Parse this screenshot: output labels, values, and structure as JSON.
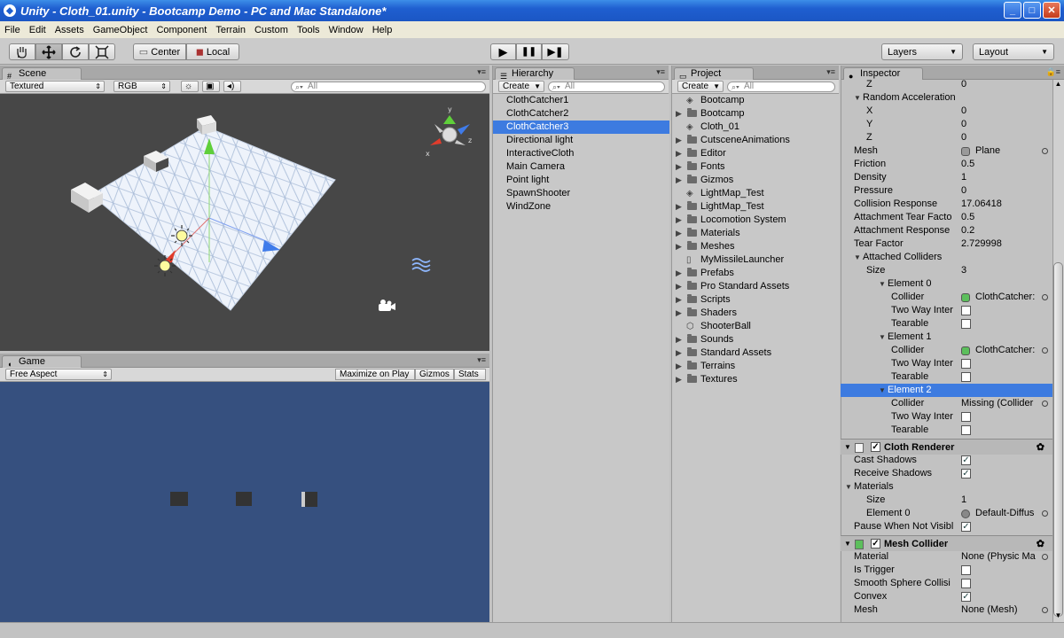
{
  "window": {
    "title": "Unity - Cloth_01.unity - Bootcamp Demo - PC and Mac Standalone*",
    "min": "_",
    "max": "□",
    "close": "✕"
  },
  "menu": [
    "File",
    "Edit",
    "Assets",
    "GameObject",
    "Component",
    "Terrain",
    "Custom",
    "Tools",
    "Window",
    "Help"
  ],
  "toolbar": {
    "tools": [
      "hand-icon",
      "move-icon",
      "rotate-icon",
      "scale-icon"
    ],
    "center_label": "Center",
    "local_label": "Local",
    "play_glyph": "▶",
    "pause_glyph": "❚❚",
    "step_glyph": "▶❚",
    "layers_label": "Layers",
    "layout_label": "Layout"
  },
  "scene": {
    "tab": "Scene",
    "render_mode": "Textured",
    "color_mode": "RGB",
    "search_placeholder": "All",
    "gizmo": {
      "x": "x",
      "y": "y",
      "z": "z"
    }
  },
  "game": {
    "tab": "Game",
    "aspect": "Free Aspect",
    "maximize": "Maximize on Play",
    "gizmos": "Gizmos",
    "stats": "Stats",
    "bg_color": "#36507f"
  },
  "hierarchy": {
    "tab": "Hierarchy",
    "create": "Create",
    "search_placeholder": "All",
    "items": [
      "ClothCatcher1",
      "ClothCatcher2",
      "ClothCatcher3",
      "Directional light",
      "InteractiveCloth",
      "Main Camera",
      "Point light",
      "SpawnShooter",
      "WindZone"
    ],
    "selected_index": 2
  },
  "project": {
    "tab": "Project",
    "create": "Create",
    "search_placeholder": "All",
    "items": [
      {
        "label": "Bootcamp",
        "icon": "unity-icon",
        "fold": false
      },
      {
        "label": "Bootcamp",
        "icon": "folder-icon",
        "fold": true
      },
      {
        "label": "Cloth_01",
        "icon": "unity-icon",
        "fold": false
      },
      {
        "label": "CutsceneAnimations",
        "icon": "folder-icon",
        "fold": true
      },
      {
        "label": "Editor",
        "icon": "folder-icon",
        "fold": true
      },
      {
        "label": "Fonts",
        "icon": "folder-icon",
        "fold": true
      },
      {
        "label": "Gizmos",
        "icon": "folder-icon",
        "fold": true
      },
      {
        "label": "LightMap_Test",
        "icon": "unity-icon",
        "fold": false
      },
      {
        "label": "LightMap_Test",
        "icon": "folder-icon",
        "fold": true
      },
      {
        "label": "Locomotion System",
        "icon": "folder-icon",
        "fold": true
      },
      {
        "label": "Materials",
        "icon": "folder-icon",
        "fold": true
      },
      {
        "label": "Meshes",
        "icon": "folder-icon",
        "fold": true
      },
      {
        "label": "MyMissileLauncher",
        "icon": "file-icon",
        "fold": false
      },
      {
        "label": "Prefabs",
        "icon": "folder-icon",
        "fold": true
      },
      {
        "label": "Pro Standard Assets",
        "icon": "folder-icon",
        "fold": true
      },
      {
        "label": "Scripts",
        "icon": "folder-icon",
        "fold": true
      },
      {
        "label": "Shaders",
        "icon": "folder-icon",
        "fold": true
      },
      {
        "label": "ShooterBall",
        "icon": "prefab-icon",
        "fold": false
      },
      {
        "label": "Sounds",
        "icon": "folder-icon",
        "fold": true
      },
      {
        "label": "Standard Assets",
        "icon": "folder-icon",
        "fold": true
      },
      {
        "label": "Terrains",
        "icon": "folder-icon",
        "fold": true
      },
      {
        "label": "Textures",
        "icon": "folder-icon",
        "fold": true
      }
    ]
  },
  "inspector": {
    "tab": "Inspector",
    "rows": [
      {
        "label": "Z",
        "indent": 2,
        "value": "0"
      },
      {
        "label": "Random Acceleration",
        "indent": 1,
        "fold": "open"
      },
      {
        "label": "X",
        "indent": 2,
        "value": "0"
      },
      {
        "label": "Y",
        "indent": 2,
        "value": "0"
      },
      {
        "label": "Z",
        "indent": 2,
        "value": "0"
      },
      {
        "label": "Mesh",
        "indent": 1,
        "value": "Plane",
        "object": true
      },
      {
        "label": "Friction",
        "indent": 1,
        "value": "0.5"
      },
      {
        "label": "Density",
        "indent": 1,
        "value": "1"
      },
      {
        "label": "Pressure",
        "indent": 1,
        "value": "0"
      },
      {
        "label": "Collision Response",
        "indent": 1,
        "value": "17.06418"
      },
      {
        "label": "Attachment Tear Facto",
        "indent": 1,
        "value": "0.5"
      },
      {
        "label": "Attachment Response",
        "indent": 1,
        "value": "0.2"
      },
      {
        "label": "Tear Factor",
        "indent": 1,
        "value": "2.729998"
      },
      {
        "label": "Attached Colliders",
        "indent": 1,
        "fold": "open"
      },
      {
        "label": "Size",
        "indent": 2,
        "value": "3"
      },
      {
        "label": "Element 0",
        "indent": 3,
        "fold": "open"
      },
      {
        "label": "Collider",
        "indent": 4,
        "value": "ClothCatcher:",
        "object": true,
        "goicon": true
      },
      {
        "label": "Two Way Inter",
        "indent": 4,
        "check": false
      },
      {
        "label": "Tearable",
        "indent": 4,
        "check": false
      },
      {
        "label": "Element 1",
        "indent": 3,
        "fold": "open"
      },
      {
        "label": "Collider",
        "indent": 4,
        "value": "ClothCatcher:",
        "object": true,
        "goicon": true
      },
      {
        "label": "Two Way Inter",
        "indent": 4,
        "check": false
      },
      {
        "label": "Tearable",
        "indent": 4,
        "check": false
      },
      {
        "label": "Element 2",
        "indent": 3,
        "fold": "open",
        "selected": true
      },
      {
        "label": "Collider",
        "indent": 4,
        "value": "Missing (Collider",
        "object": true
      },
      {
        "label": "Two Way Inter",
        "indent": 4,
        "check": false
      },
      {
        "label": "Tearable",
        "indent": 4,
        "check": false
      }
    ],
    "cloth_renderer": {
      "title": "Cloth Renderer",
      "rows": [
        {
          "label": "Cast Shadows",
          "indent": 1,
          "check": true
        },
        {
          "label": "Receive Shadows",
          "indent": 1,
          "check": true
        },
        {
          "label": "Materials",
          "indent": 0,
          "fold": "open"
        },
        {
          "label": "Size",
          "indent": 2,
          "value": "1"
        },
        {
          "label": "Element 0",
          "indent": 2,
          "value": "Default-Diffus",
          "object": true,
          "sphere": true
        },
        {
          "label": "Pause When Not Visibl",
          "indent": 1,
          "check": true
        }
      ]
    },
    "mesh_collider": {
      "title": "Mesh Collider",
      "rows": [
        {
          "label": "Material",
          "indent": 1,
          "value": "None (Physic Ma",
          "object": true
        },
        {
          "label": "Is Trigger",
          "indent": 1,
          "check": false
        },
        {
          "label": "Smooth Sphere Collisi",
          "indent": 1,
          "check": false
        },
        {
          "label": "Convex",
          "indent": 1,
          "check": true
        },
        {
          "label": "Mesh",
          "indent": 1,
          "value": "None (Mesh)",
          "object": true
        }
      ]
    }
  }
}
